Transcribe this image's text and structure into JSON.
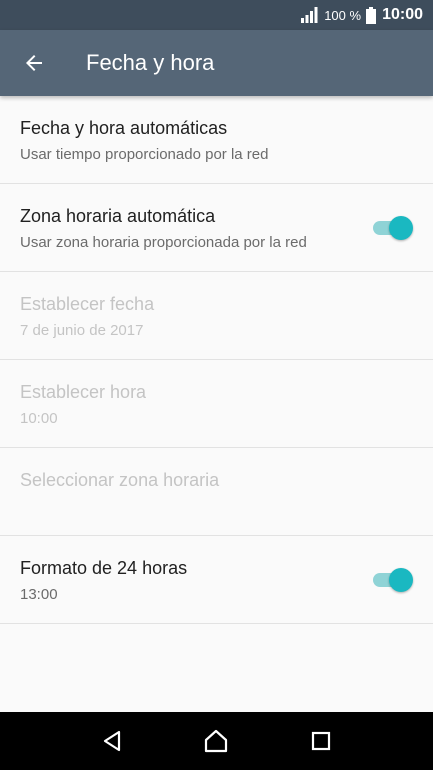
{
  "status_bar": {
    "battery_percent": "100 %",
    "time": "10:00"
  },
  "app_bar": {
    "title": "Fecha y hora"
  },
  "settings": [
    {
      "title": "Fecha y hora automáticas",
      "subtitle": "Usar tiempo proporcionado por la red",
      "enabled": true,
      "toggle": null
    },
    {
      "title": "Zona horaria automática",
      "subtitle": "Usar zona horaria proporcionada por la red",
      "enabled": true,
      "toggle": true
    },
    {
      "title": "Establecer fecha",
      "subtitle": "7 de junio de 2017",
      "enabled": false,
      "toggle": null
    },
    {
      "title": "Establecer hora",
      "subtitle": "10:00",
      "enabled": false,
      "toggle": null
    },
    {
      "title": "Seleccionar zona horaria",
      "subtitle": "",
      "enabled": false,
      "toggle": null
    },
    {
      "title": "Formato de 24 horas",
      "subtitle": "13:00",
      "enabled": true,
      "toggle": true
    }
  ],
  "colors": {
    "status_bar": "#3e4d5c",
    "app_bar": "#556677",
    "accent": "#1ab8c1",
    "accent_track": "#8fd3d6"
  },
  "icons": {
    "back": "arrow-left-icon",
    "signal": "signal-icon",
    "battery": "battery-icon",
    "nav_back": "triangle-back-icon",
    "nav_home": "home-icon",
    "nav_recents": "square-recents-icon"
  }
}
